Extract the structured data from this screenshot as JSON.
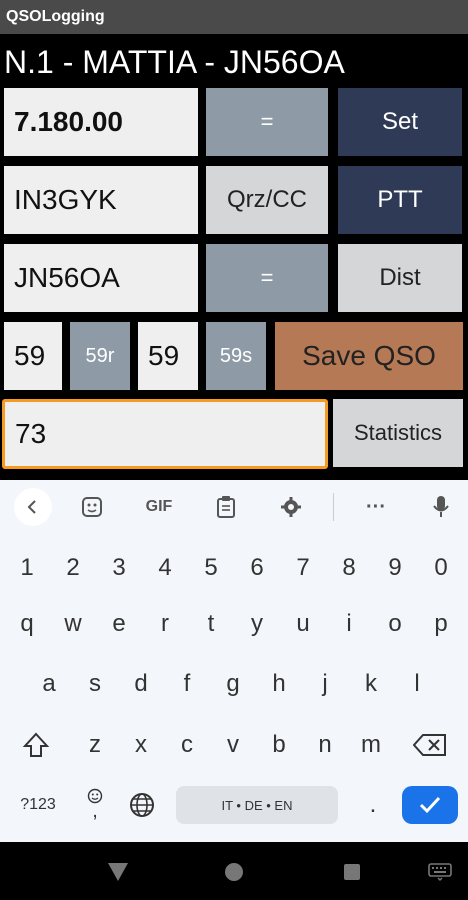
{
  "app": {
    "title": "QSOLogging"
  },
  "header": {
    "text": "N.1 - MATTIA - JN56OA"
  },
  "form": {
    "frequency_value": "7.180.00",
    "callsign_value": "IN3GYK",
    "locator_value": "JN56OA",
    "rst_sent_value": "59",
    "rst_rcvd_value": "59",
    "note_value": "73"
  },
  "buttons": {
    "eq1": "=",
    "set": "Set",
    "qrz": "Qrz/CC",
    "ptt": "PTT",
    "eq2": "=",
    "dist": "Dist",
    "r59": "59r",
    "s59": "59s",
    "save": "Save QSO",
    "stats": "Statistics"
  },
  "keyboard": {
    "toolbar": {
      "gif": "GIF",
      "more": "···"
    },
    "row_numbers": [
      "1",
      "2",
      "3",
      "4",
      "5",
      "6",
      "7",
      "8",
      "9",
      "0"
    ],
    "row1": [
      "q",
      "w",
      "e",
      "r",
      "t",
      "y",
      "u",
      "i",
      "o",
      "p"
    ],
    "row2": [
      "a",
      "s",
      "d",
      "f",
      "g",
      "h",
      "j",
      "k",
      "l"
    ],
    "row3": [
      "z",
      "x",
      "c",
      "v",
      "b",
      "n",
      "m"
    ],
    "symbols_label": "?123",
    "emoji_comma": ",",
    "space_label": "IT • DE • EN",
    "period": "."
  },
  "colors": {
    "accent_orange": "#f59a23",
    "btn_dark": "#2f3a56",
    "btn_gray": "#8e9ba6",
    "btn_orange": "#b57a55",
    "enter_blue": "#1a73e8"
  }
}
